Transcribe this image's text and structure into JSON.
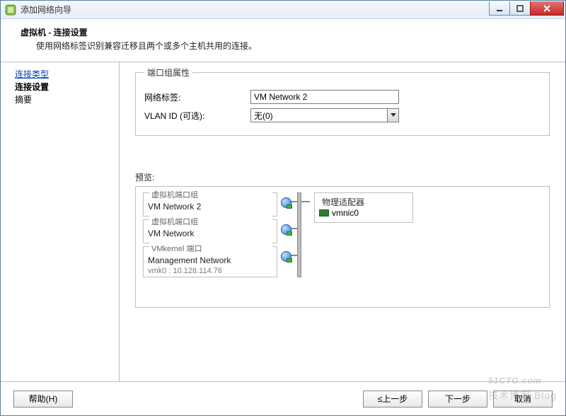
{
  "window": {
    "title": "添加网络向导"
  },
  "header": {
    "title": "虚拟机 - 连接设置",
    "subtitle": "使用网络标签识别兼容迁移且两个或多个主机共用的连接。"
  },
  "sidebar": {
    "step_connection_type": "连接类型",
    "step_connection_settings": "连接设置",
    "step_summary": "摘要"
  },
  "portgroup_props": {
    "legend": "端口组属性",
    "label_network": "网络标签:",
    "value_network": "VM Network 2",
    "label_vlan": "VLAN ID (可选):",
    "value_vlan": "无(0)"
  },
  "preview": {
    "label": "预览:",
    "vm_portgroup_legend": "虚拟机端口组",
    "vmkernel_legend": "VMkernel 端口",
    "physical_legend": "物理适配器",
    "pg1_name": "VM Network 2",
    "pg2_name": "VM Network",
    "pg3_name": "Management Network",
    "pg3_sub": "vmk0 : 10.128.114.76",
    "phys_nic": "vmnic0"
  },
  "footer": {
    "help": "帮助(H)",
    "back": "≤上一步",
    "next": "下一步",
    "cancel": "取消"
  },
  "watermark": {
    "main": "51CTO.com",
    "sub": "技术博客 Blog"
  }
}
